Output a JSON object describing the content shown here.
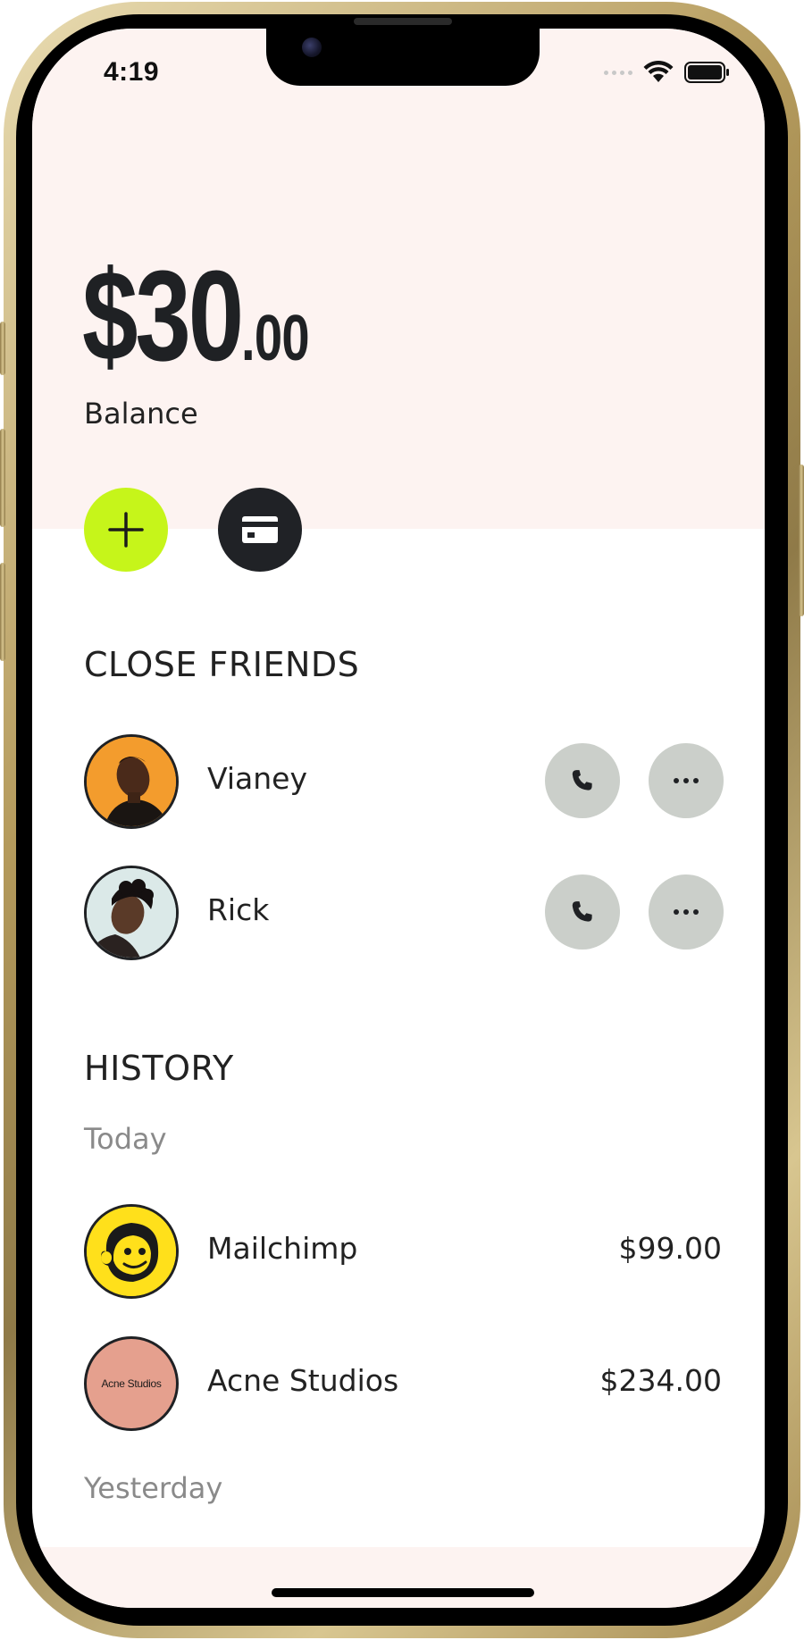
{
  "status_bar": {
    "time": "4:19"
  },
  "balance": {
    "dollars": "$30",
    "cents": ".00",
    "label": "Balance"
  },
  "actions": {
    "add_icon": "plus-icon",
    "card_icon": "card-icon"
  },
  "close_friends": {
    "title": "CLOSE FRIENDS",
    "items": [
      {
        "name": "Vianey",
        "avatar_bg": "#f39c2d"
      },
      {
        "name": "Rick",
        "avatar_bg": "#dbe9e8"
      }
    ]
  },
  "history": {
    "title": "HISTORY",
    "groups": [
      {
        "label": "Today",
        "items": [
          {
            "name": "Mailchimp",
            "amount": "$99.00",
            "logo_bg": "#ffe01b"
          },
          {
            "name": "Acne Studios",
            "amount": "$234.00",
            "logo_bg": "#e5a08e",
            "logo_text": "Acne Studios"
          }
        ]
      },
      {
        "label": "Yesterday",
        "items": []
      }
    ]
  },
  "colors": {
    "accent": "#c6f51a",
    "dark": "#202226",
    "top_bg": "#fdf3f1",
    "action_btn": "#cbcfca"
  }
}
